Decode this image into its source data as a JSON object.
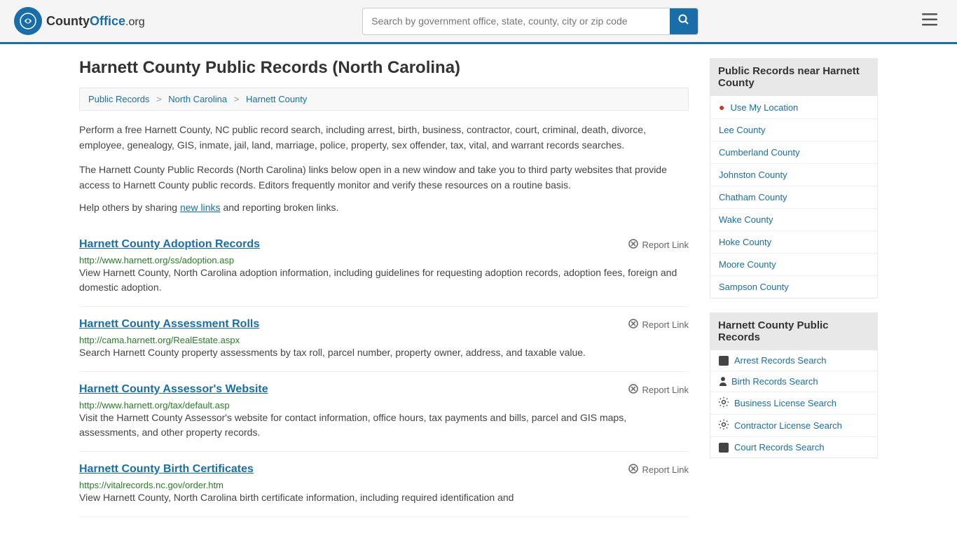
{
  "header": {
    "logo_text": "County",
    "logo_suffix": "Office.org",
    "search_placeholder": "Search by government office, state, county, city or zip code",
    "search_btn_label": "🔍",
    "menu_btn_label": "≡"
  },
  "page": {
    "title": "Harnett County Public Records (North Carolina)",
    "breadcrumbs": [
      {
        "label": "Public Records",
        "href": "#"
      },
      {
        "label": "North Carolina",
        "href": "#"
      },
      {
        "label": "Harnett County",
        "href": "#"
      }
    ],
    "intro1": "Perform a free Harnett County, NC public record search, including arrest, birth, business, contractor, court, criminal, death, divorce, employee, genealogy, GIS, inmate, jail, land, marriage, police, property, sex offender, tax, vital, and warrant records searches.",
    "intro2": "The Harnett County Public Records (North Carolina) links below open in a new window and take you to third party websites that provide access to Harnett County public records. Editors frequently monitor and verify these resources on a routine basis.",
    "share_text_pre": "Help others by sharing ",
    "share_link": "new links",
    "share_text_post": " and reporting broken links."
  },
  "records": [
    {
      "title": "Harnett County Adoption Records",
      "url": "http://www.harnett.org/ss/adoption.asp",
      "description": "View Harnett County, North Carolina adoption information, including guidelines for requesting adoption records, adoption fees, foreign and domestic adoption."
    },
    {
      "title": "Harnett County Assessment Rolls",
      "url": "http://cama.harnett.org/RealEstate.aspx",
      "description": "Search Harnett County property assessments by tax roll, parcel number, property owner, address, and taxable value."
    },
    {
      "title": "Harnett County Assessor's Website",
      "url": "http://www.harnett.org/tax/default.asp",
      "description": "Visit the Harnett County Assessor's website for contact information, office hours, tax payments and bills, parcel and GIS maps, assessments, and other property records."
    },
    {
      "title": "Harnett County Birth Certificates",
      "url": "https://vitalrecords.nc.gov/order.htm",
      "description": "View Harnett County, North Carolina birth certificate information, including required identification and"
    }
  ],
  "report_label": "Report Link",
  "sidebar": {
    "nearby_header": "Public Records near Harnett County",
    "nearby_items": [
      {
        "label": "Use My Location",
        "icon": "location"
      },
      {
        "label": "Lee County",
        "icon": "none"
      },
      {
        "label": "Cumberland County",
        "icon": "none"
      },
      {
        "label": "Johnston County",
        "icon": "none"
      },
      {
        "label": "Chatham County",
        "icon": "none"
      },
      {
        "label": "Wake County",
        "icon": "none"
      },
      {
        "label": "Hoke County",
        "icon": "none"
      },
      {
        "label": "Moore County",
        "icon": "none"
      },
      {
        "label": "Sampson County",
        "icon": "none"
      }
    ],
    "public_records_header": "Harnett County Public Records",
    "public_records_items": [
      {
        "label": "Arrest Records Search",
        "icon": "square"
      },
      {
        "label": "Birth Records Search",
        "icon": "person"
      },
      {
        "label": "Business License Search",
        "icon": "gear2"
      },
      {
        "label": "Contractor License Search",
        "icon": "gear"
      },
      {
        "label": "Court Records Search",
        "icon": "court"
      }
    ]
  }
}
